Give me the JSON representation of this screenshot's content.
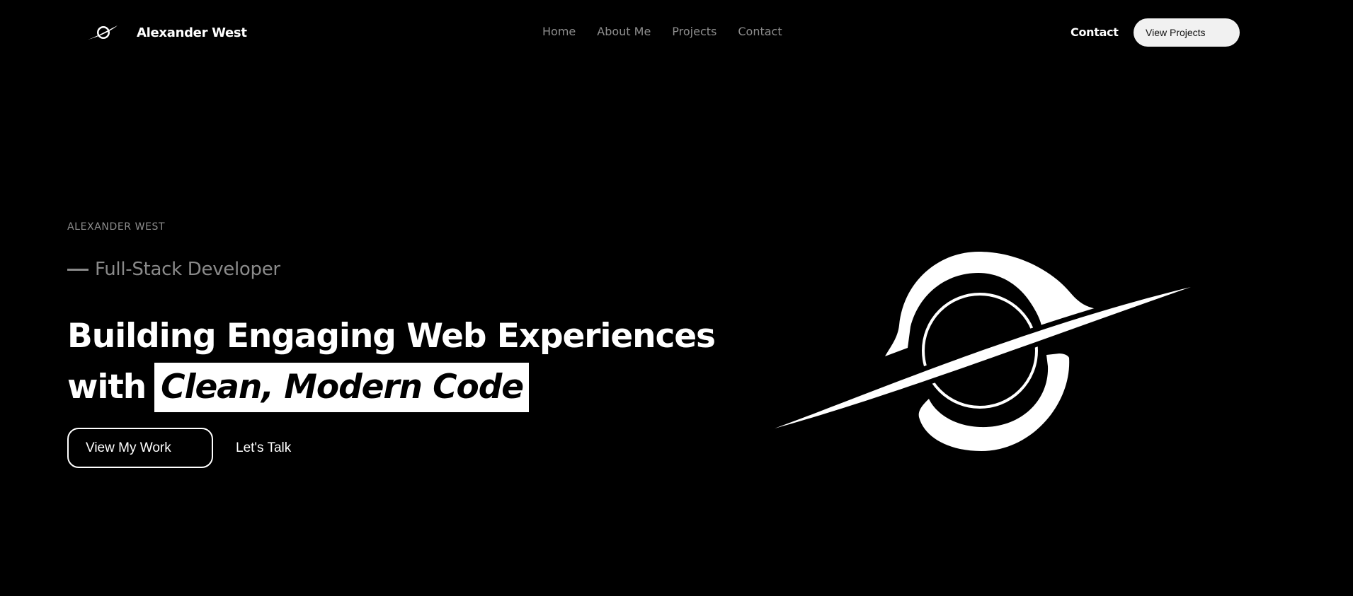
{
  "header": {
    "brand_name": "Alexander West",
    "brand_logo_icon": "planet-ring-icon",
    "nav": [
      {
        "label": "Home"
      },
      {
        "label": "About Me"
      },
      {
        "label": "Projects"
      },
      {
        "label": "Contact"
      }
    ],
    "contact_label": "Contact",
    "cta_label": "View Projects"
  },
  "hero": {
    "eyebrow": "ALEXANDER WEST",
    "subtitle": "Full-Stack Developer",
    "headline_line1": "Building Engaging Web Experiences",
    "headline_line2_prefix": "with",
    "headline_highlight": "Clean, Modern Code",
    "primary_cta": "View My Work",
    "secondary_cta": "Let's Talk",
    "emblem_icon": "planet-ring-icon"
  },
  "colors": {
    "background": "#000000",
    "text": "#ffffff",
    "muted": "#8e8e8e",
    "cta_background": "#f1f1f1"
  }
}
